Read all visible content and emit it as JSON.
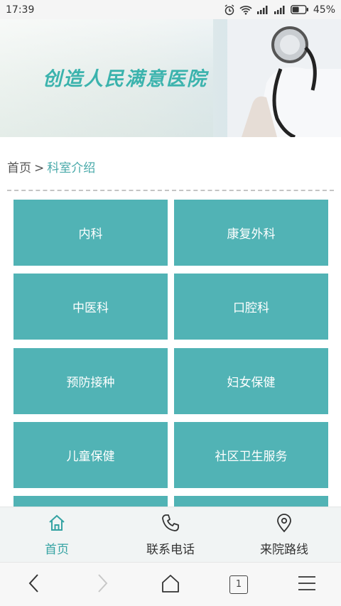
{
  "status_bar": {
    "time": "17:39",
    "battery": "45%"
  },
  "banner": {
    "title": "创造人民满意医院"
  },
  "breadcrumb": {
    "home": "首页",
    "separator": ">",
    "current": "科室介绍"
  },
  "departments": [
    "内科",
    "康复外科",
    "中医科",
    "口腔科",
    "预防接种",
    "妇女保健",
    "儿童保健",
    "社区卫生服务"
  ],
  "bottom_nav": {
    "home": "首页",
    "phone": "联系电话",
    "route": "来院路线"
  },
  "browser": {
    "tab_count": "1"
  },
  "colors": {
    "accent": "#51b3b5",
    "nav_active": "#35a3a3"
  }
}
